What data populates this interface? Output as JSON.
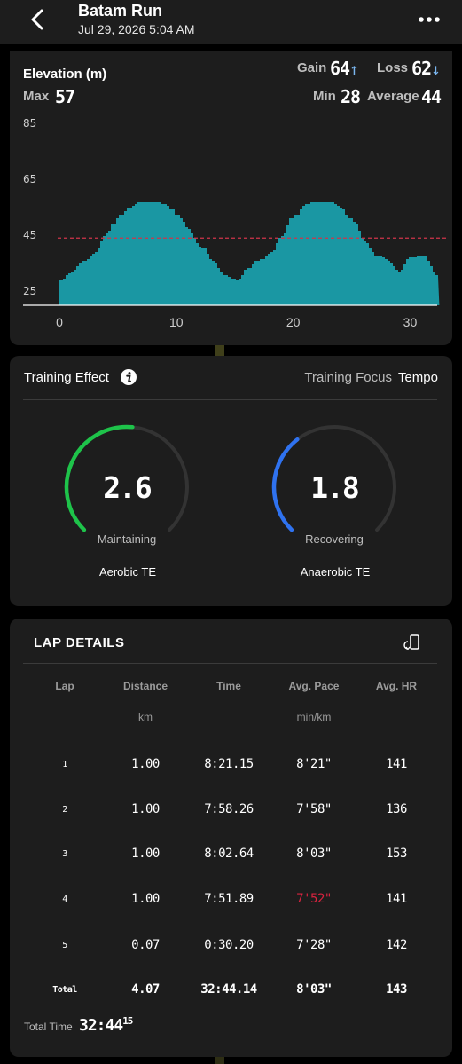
{
  "header": {
    "title": "Batam Run",
    "subtitle": "Jul 29, 2026 5:04 AM"
  },
  "elevation": {
    "title": "Elevation (m)",
    "gain_label": "Gain",
    "gain_value": "64",
    "loss_label": "Loss",
    "loss_value": "62",
    "max_label": "Max",
    "max_value": "57",
    "min_label": "Min",
    "min_value": "28",
    "avg_label": "Average",
    "avg_value": "44",
    "colors": {
      "fill": "#1a97a3",
      "avg_line": "#d0344a",
      "up_arrow": "#7ab6ef"
    }
  },
  "chart_data": {
    "type": "area",
    "x_ticks": [
      "0",
      "10",
      "20",
      "30"
    ],
    "y_ticks": [
      "85",
      "65",
      "45",
      "25"
    ],
    "xlim": [
      0,
      33
    ],
    "ylim": [
      20,
      90
    ],
    "average": 44,
    "x": [
      0,
      1,
      2,
      3,
      4,
      5,
      6,
      7,
      8,
      9,
      10,
      11,
      12,
      13,
      14,
      15,
      16,
      17,
      18,
      19,
      20,
      21,
      22,
      23,
      24,
      25,
      26,
      27,
      28,
      29,
      30,
      31,
      32.5
    ],
    "y": [
      29,
      32,
      36,
      39,
      46,
      52,
      55,
      57,
      57,
      56,
      52,
      47,
      41,
      36,
      31,
      29,
      33,
      36,
      39,
      45,
      52,
      56,
      57,
      57,
      55,
      50,
      43,
      38,
      36,
      32,
      37,
      38,
      30
    ]
  },
  "training": {
    "title": "Training Effect",
    "focus_label": "Training Focus",
    "focus_value": "Tempo",
    "aerobic": {
      "value": "2.6",
      "fraction": 0.52,
      "status": "Maintaining",
      "name": "Aerobic TE",
      "color": "#1ec34a"
    },
    "anaerobic": {
      "value": "1.8",
      "fraction": 0.36,
      "status": "Recovering",
      "name": "Anaerobic TE",
      "color": "#2f72ef"
    }
  },
  "laps": {
    "title": "LAP DETAILS",
    "headers": [
      "Lap",
      "Distance",
      "Time",
      "Avg. Pace",
      "Avg. HR"
    ],
    "units": [
      "",
      "km",
      "",
      "min/km",
      ""
    ],
    "rows": [
      [
        "1",
        "1.00",
        "8:21.15",
        "8'21\"",
        "141"
      ],
      [
        "2",
        "1.00",
        "7:58.26",
        "7'58\"",
        "136"
      ],
      [
        "3",
        "1.00",
        "8:02.64",
        "8'03\"",
        "153"
      ],
      [
        "4",
        "1.00",
        "7:51.89",
        "7'52\"",
        "141"
      ],
      [
        "5",
        "0.07",
        "0:30.20",
        "7'28\"",
        "142"
      ]
    ],
    "total": [
      "Total",
      "4.07",
      "32:44.14",
      "8'03\"",
      "143"
    ],
    "highlight_color": "#d9233f",
    "total_time_label": "Total Time",
    "total_time_main": "32:44",
    "total_time_frac": "15"
  }
}
